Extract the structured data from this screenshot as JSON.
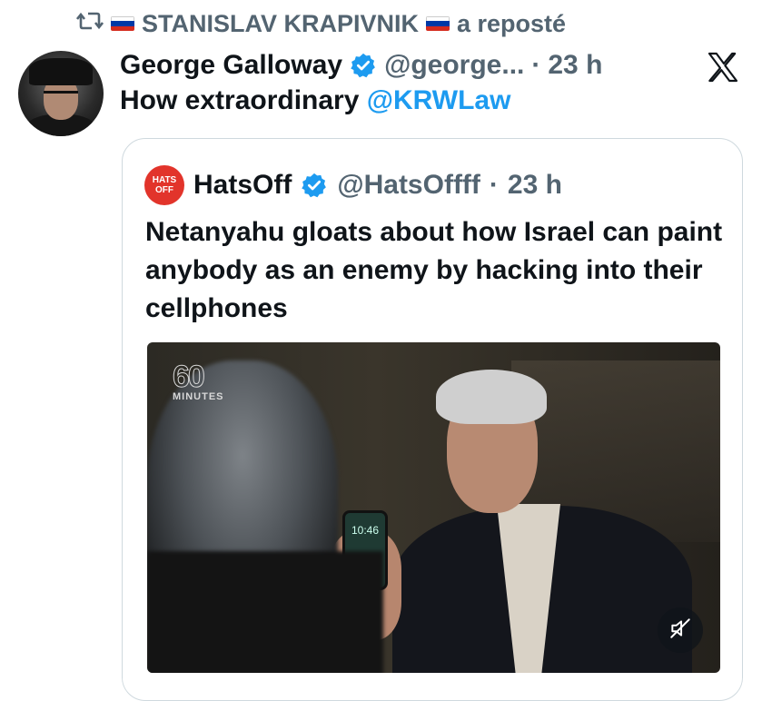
{
  "repost": {
    "reposter_name": "STANISLAV KRAPIVNIK",
    "suffix": "a reposté",
    "flag_colors": [
      "#ffffff",
      "#0039a6",
      "#d52b1e"
    ]
  },
  "tweet": {
    "author_name": "George Galloway",
    "handle": "@george...",
    "separator": "·",
    "time": "23 h",
    "text_prefix": "How extraordinary ",
    "mention": "@KRWLaw"
  },
  "quote": {
    "avatar_text_line1": "HATS",
    "avatar_text_line2": "OFF",
    "author_name": "HatsOff",
    "handle": "@HatsOffff",
    "separator": "·",
    "time": "23 h",
    "text": "Netanyahu gloats about how Israel can paint anybody as an enemy by hacking into their cellphones",
    "video": {
      "logo_number": "60",
      "logo_text": "MINUTES",
      "phone_time": "10:46"
    }
  },
  "icons": {
    "repost": "repost-icon",
    "verified": "verified-badge-icon",
    "x_logo": "x-logo-icon",
    "mute": "mute-icon"
  },
  "colors": {
    "accent": "#1d9bf0",
    "secondary_text": "#536471",
    "quote_avatar": "#e2342b"
  }
}
